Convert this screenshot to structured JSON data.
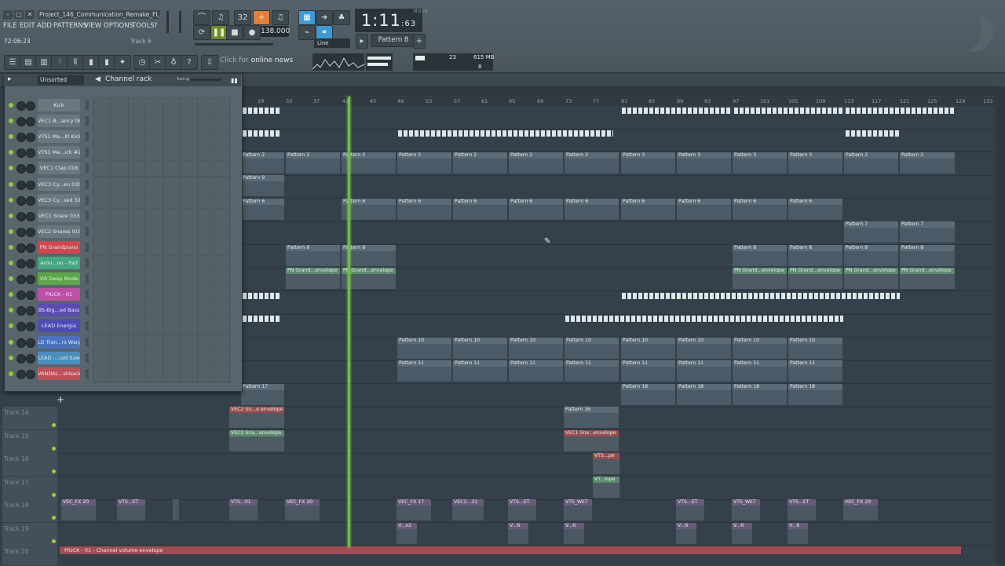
{
  "window": {
    "title": "Project_146_Communication_Remake_FL_1...",
    "minimize": "–",
    "restore": "□",
    "close": "✕"
  },
  "menu": [
    "FILE",
    "EDIT",
    "ADD",
    "PATTERNS",
    "VIEW",
    "OPTIONS",
    "TOOLS",
    "?"
  ],
  "hint": {
    "time": "72:06:23",
    "track": "Track 6"
  },
  "transport": {
    "tempo": "138.000",
    "song_time": "1:11",
    "song_time_frac": ":63",
    "time_unit": "M:S:CS",
    "pattern": "Pattern 8",
    "line_mode": "Line"
  },
  "news": {
    "prefix": "Click for",
    "link": "online news"
  },
  "monitor": {
    "cpu": "23",
    "memory": "615 MB",
    "polyphony": "8"
  },
  "ruler": [
    "29",
    "33",
    "37",
    "41",
    "45",
    "49",
    "53",
    "57",
    "61",
    "65",
    "69",
    "73",
    "77",
    "81",
    "85",
    "89",
    "93",
    "97",
    "101",
    "105",
    "109",
    "113",
    "117",
    "121",
    "125",
    "129",
    "133"
  ],
  "tracks": [
    "Track 14",
    "Track 15",
    "Track 16",
    "Track 17",
    "Track 18",
    "Track 19",
    "Track 20"
  ],
  "clips": {
    "p2": "Pattern 2",
    "p3": "Pattern 3",
    "p9": "Pattern 9",
    "p6": "Pattern 6",
    "p7": "Pattern 7",
    "p8": "Pattern 8",
    "p10": "Pattern 10",
    "p11": "Pattern 11",
    "p17": "Pattern 17",
    "p18": "Pattern 18",
    "p16": "Pattern 16",
    "pn_env": "PN Grand...envelope",
    "vec2_env_a": "VEC2 Sn...e envelope",
    "vec2_env_b": "VEC2 Sna...envelope",
    "vec1_env": "VEC1 Sna...envelope",
    "vts_pe": "VTS...pe",
    "vt_lope": "VT...lope",
    "a_vecfx20": "VEC_FX 20",
    "a_vtset": "VTS...ET",
    "a_vts01": "VTS...01",
    "a_vecfx17": "VEC_FX 17",
    "a_vec231": "VEC2...31",
    "a_vtswet": "VTS_WET",
    "a_vx2": "V...x2",
    "a_v6": "V...6",
    "piuck_env": "PIUCK - 01 - Channel volume envelope"
  },
  "rack": {
    "filter": "Unsorted",
    "title": "Channel rack",
    "swing": "Swing",
    "add": "+",
    "channels": [
      {
        "name": "Kick",
        "color": "#6b767e"
      },
      {
        "name": "VEC1 B...ancy 06",
        "color": "#6b767e"
      },
      {
        "name": "VTS1 Ma...M Kick",
        "color": "#6b767e"
      },
      {
        "name": "VTS1 Ma...ick #2",
        "color": "#6b767e"
      },
      {
        "name": "VEC1 Clap 018",
        "color": "#6b767e"
      },
      {
        "name": "VEC3 Cy...en 030",
        "color": "#6b767e"
      },
      {
        "name": "VEC3 Cy...sed 32",
        "color": "#6b767e"
      },
      {
        "name": "VEC1 Snare 033",
        "color": "#6b767e"
      },
      {
        "name": "VEC2 Snares 019",
        "color": "#6b767e"
      },
      {
        "name": "PN Grandpiano",
        "color": "#d04650"
      },
      {
        "name": "Armi...on - Pad",
        "color": "#45a880"
      },
      {
        "name": "VO Deep Mode",
        "color": "#5aa845"
      },
      {
        "name": "PIUCK - 01",
        "color": "#c04fa6"
      },
      {
        "name": "BS-Big...ed Bass",
        "color": "#5a4bb5"
      },
      {
        "name": "LEAD Energia",
        "color": "#4e4bb8"
      },
      {
        "name": "LD Tran...rs Warp",
        "color": "#4a72c0"
      },
      {
        "name": "LEAD -...uid Saw",
        "color": "#4a8fc0"
      },
      {
        "name": "VANDAL...shback",
        "color": "#c04f58"
      }
    ]
  },
  "colors": {
    "playhead": "#6fbf3a",
    "accent": "#e0803a",
    "highlight": "#3c9ad6"
  }
}
